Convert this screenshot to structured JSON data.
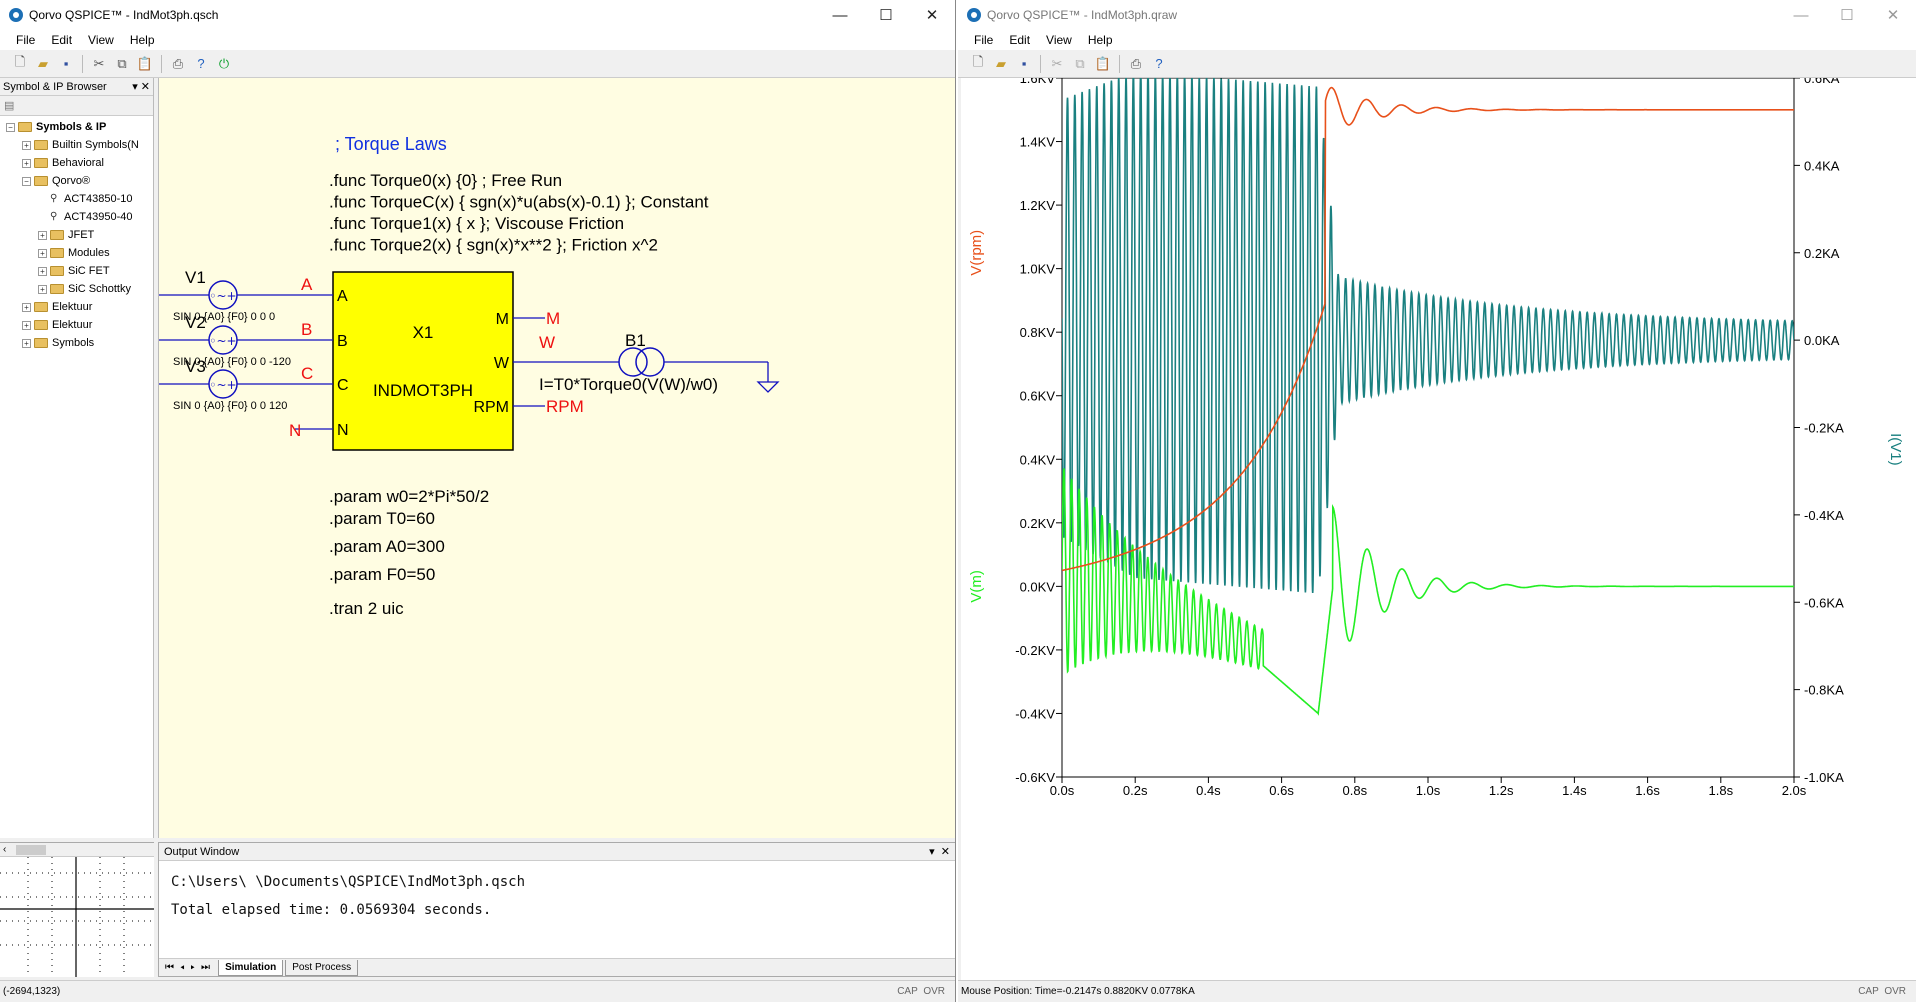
{
  "editor": {
    "title": "Qorvo QSPICE™ - IndMot3ph.qsch",
    "menus": [
      "File",
      "Edit",
      "View",
      "Help"
    ],
    "sidebar_title": "Symbol & IP Browser",
    "tree": [
      {
        "label": "Symbols & IP",
        "level": 0,
        "expander": "−",
        "bold": true
      },
      {
        "label": "Builtin Symbols(N",
        "level": 1,
        "expander": "+"
      },
      {
        "label": "Behavioral",
        "level": 1,
        "expander": "+"
      },
      {
        "label": "Qorvo®",
        "level": 1,
        "expander": "−"
      },
      {
        "label": "ACT43850-10",
        "level": 2,
        "expander": "",
        "chip": true
      },
      {
        "label": "ACT43950-40",
        "level": 2,
        "expander": "",
        "chip": true
      },
      {
        "label": "JFET",
        "level": 2,
        "expander": "+"
      },
      {
        "label": "Modules",
        "level": 2,
        "expander": "+"
      },
      {
        "label": "SiC FET",
        "level": 2,
        "expander": "+"
      },
      {
        "label": "SiC Schottky",
        "level": 2,
        "expander": "+"
      },
      {
        "label": "Elektuur",
        "level": 1,
        "expander": "+"
      },
      {
        "label": "Elektuur",
        "level": 1,
        "expander": "+"
      },
      {
        "label": "Symbols",
        "level": 1,
        "expander": "+"
      }
    ],
    "schematic": {
      "comment": "; Torque Laws",
      "funcs": [
        ".func Torque0(x) {0} ; Free Run",
        ".func TorqueC(x) { sgn(x)*u(abs(x)-0.1) }; Constant",
        ".func Torque1(x) { x }; Viscouse Friction",
        ".func Torque2(x) { sgn(x)*x**2 }; Friction x^2"
      ],
      "params": [
        ".param w0=2*Pi*50/2",
        ".param T0=60",
        ".param A0=300",
        ".param F0=50"
      ],
      "tran": ".tran 2 uic",
      "sources": [
        {
          "name": "V1",
          "spec": "SIN 0 {A0} {F0} 0 0 0",
          "net": "A"
        },
        {
          "name": "V2",
          "spec": "SIN 0 {A0} {F0} 0 0 -120",
          "net": "B"
        },
        {
          "name": "V3",
          "spec": "SIN 0 {A0} {F0} 0 0 120",
          "net": "C"
        }
      ],
      "block": {
        "name": "X1",
        "type": "INDMOT3PH",
        "pins_left": [
          "A",
          "B",
          "C",
          "N"
        ],
        "pins_right": [
          "M",
          "W",
          "RPM"
        ]
      },
      "n_net": "N",
      "m_net": "M",
      "rpm_net": "RPM",
      "w_net": "W",
      "b1": {
        "name": "B1",
        "expr": "I=T0*Torque0(V(W)/w0)"
      }
    },
    "output": {
      "title": "Output Window",
      "lines": [
        "C:\\Users\\     \\Documents\\QSPICE\\IndMot3ph.qsch",
        "Total elapsed time: 0.0569304 seconds."
      ],
      "tabs": [
        "Simulation",
        "Post Process"
      ]
    },
    "status": {
      "coords": "(-2694,1323)",
      "cap": "CAP",
      "ovr": "OVR"
    }
  },
  "waveform": {
    "title": "Qorvo QSPICE™ - IndMot3ph.qraw",
    "menus": [
      "File",
      "Edit",
      "View",
      "Help"
    ],
    "status": {
      "mouse": "Mouse Position: Time=-0.2147s  0.8820KV 0.0778KA",
      "cap": "CAP",
      "ovr": "OVR"
    }
  },
  "colors": {
    "rpm": "#e8501a",
    "m": "#22ee22",
    "i": "#1a8080",
    "wire": "#1010c0",
    "netlabel": "#ee1111",
    "block": "#ffff00",
    "directive_blue": "#1030e0"
  },
  "chart_data": {
    "type": "line",
    "x": {
      "label": "",
      "ticks": [
        "0.0s",
        "0.2s",
        "0.4s",
        "0.6s",
        "0.8s",
        "1.0s",
        "1.2s",
        "1.4s",
        "1.6s",
        "1.8s",
        "2.0s"
      ],
      "range": [
        0,
        2
      ]
    },
    "y_left": {
      "ticks": [
        "1.6KV",
        "1.4KV",
        "1.2KV",
        "1.0KV",
        "0.8KV",
        "0.6KV",
        "0.4KV",
        "0.2KV",
        "0.0KV",
        "-0.2KV",
        "-0.4KV",
        "-0.6KV"
      ],
      "range": [
        -0.6,
        1.6
      ],
      "labels": [
        "V(rpm)",
        "V(m)"
      ]
    },
    "y_right": {
      "ticks": [
        "0.6KA",
        "0.4KA",
        "0.2KA",
        "0.0KA",
        "-0.2KA",
        "-0.4KA",
        "-0.6KA",
        "-0.8KA",
        "-1.0KA"
      ],
      "range": [
        -1.0,
        0.6
      ],
      "label": "I(V1)"
    },
    "series": [
      {
        "name": "V(rpm)",
        "axis": "left",
        "points": [
          [
            0,
            0.05
          ],
          [
            0.1,
            0.13
          ],
          [
            0.2,
            0.2
          ],
          [
            0.3,
            0.29
          ],
          [
            0.4,
            0.42
          ],
          [
            0.5,
            0.63
          ],
          [
            0.6,
            0.97
          ],
          [
            0.65,
            1.22
          ],
          [
            0.7,
            1.52
          ],
          [
            0.74,
            1.58
          ],
          [
            0.79,
            1.46
          ],
          [
            0.84,
            1.54
          ],
          [
            0.9,
            1.48
          ],
          [
            0.95,
            1.52
          ],
          [
            1.05,
            1.49
          ],
          [
            1.2,
            1.505
          ],
          [
            2.0,
            1.5
          ]
        ]
      },
      {
        "name": "V(m)",
        "axis": "left",
        "envelope_note": "oscillating torque decaying to 0",
        "points": [
          [
            0,
            0.3
          ],
          [
            0.1,
            0.1
          ],
          [
            0.3,
            -0.15
          ],
          [
            0.5,
            -0.2
          ],
          [
            0.6,
            -0.3
          ],
          [
            0.7,
            -0.4
          ],
          [
            0.74,
            0.0
          ],
          [
            0.76,
            0.25
          ],
          [
            0.8,
            -0.15
          ],
          [
            0.86,
            0.12
          ],
          [
            0.9,
            -0.08
          ],
          [
            0.95,
            0.04
          ],
          [
            1.05,
            -0.02
          ],
          [
            1.2,
            0.01
          ],
          [
            2.0,
            0.0
          ]
        ]
      },
      {
        "name": "I(V1)",
        "axis": "right",
        "envelope_note": "~50 Hz sine; amplitude 0.6KA start-up, ~0.05KA steady",
        "points": [
          [
            0,
            0.0
          ],
          [
            0.7,
            0.55
          ],
          [
            0.75,
            0.1
          ],
          [
            2.0,
            0.05
          ]
        ]
      }
    ]
  }
}
